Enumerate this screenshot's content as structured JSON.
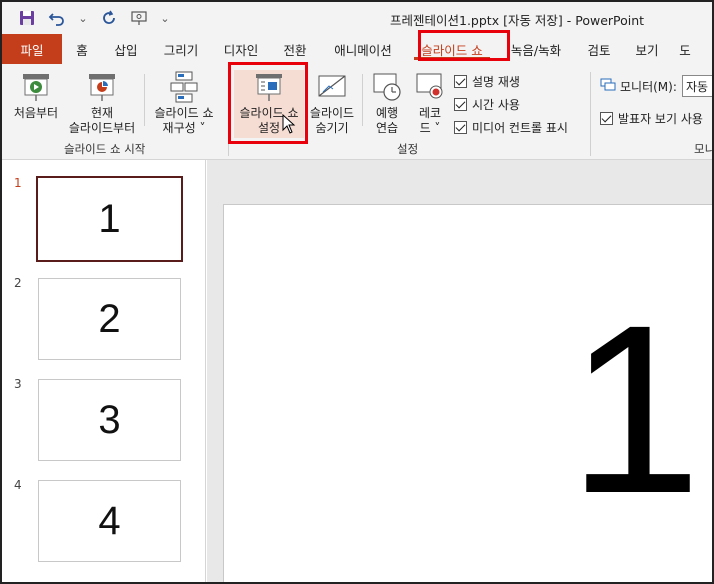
{
  "window": {
    "title": "프레젠테이션1.pptx [자동 저장]  -  PowerPoint"
  },
  "tabs": [
    {
      "label": "파일"
    },
    {
      "label": "홈"
    },
    {
      "label": "삽입"
    },
    {
      "label": "그리기"
    },
    {
      "label": "디자인"
    },
    {
      "label": "전환"
    },
    {
      "label": "애니메이션"
    },
    {
      "label": "슬라이드 쇼"
    },
    {
      "label": "녹음/녹화"
    },
    {
      "label": "검토"
    },
    {
      "label": "보기"
    },
    {
      "label": "도"
    }
  ],
  "ribbon": {
    "start_group": {
      "label": "슬라이드 쇼 시작",
      "from_beginning": "처음부터",
      "from_current_1": "현재",
      "from_current_2": "슬라이드부터",
      "custom_1": "슬라이드 쇼",
      "custom_2": "재구성 ˅"
    },
    "setup_group": {
      "label": "설정",
      "setup_1": "슬라이드 쇼",
      "setup_2": "설정",
      "hide_1": "슬라이드",
      "hide_2": "숨기기",
      "rehearse_1": "예행",
      "rehearse_2": "연습",
      "record_1": "레코",
      "record_2": "드 ˅",
      "checks": [
        "설명 재생",
        "시간 사용",
        "미디어 컨트롤 표시"
      ]
    },
    "monitor_group": {
      "monitor_label": "모니터(M):",
      "monitor_value": "자동",
      "presenter_view": "발표자 보기 사용",
      "label": "모니"
    }
  },
  "slides": [
    {
      "num": "1",
      "text": "1"
    },
    {
      "num": "2",
      "text": "2"
    },
    {
      "num": "3",
      "text": "3"
    },
    {
      "num": "4",
      "text": "4"
    }
  ],
  "canvas": {
    "slide_text": "1"
  },
  "colors": {
    "accent": "#c43e1c",
    "highlight": "#e8000b"
  }
}
